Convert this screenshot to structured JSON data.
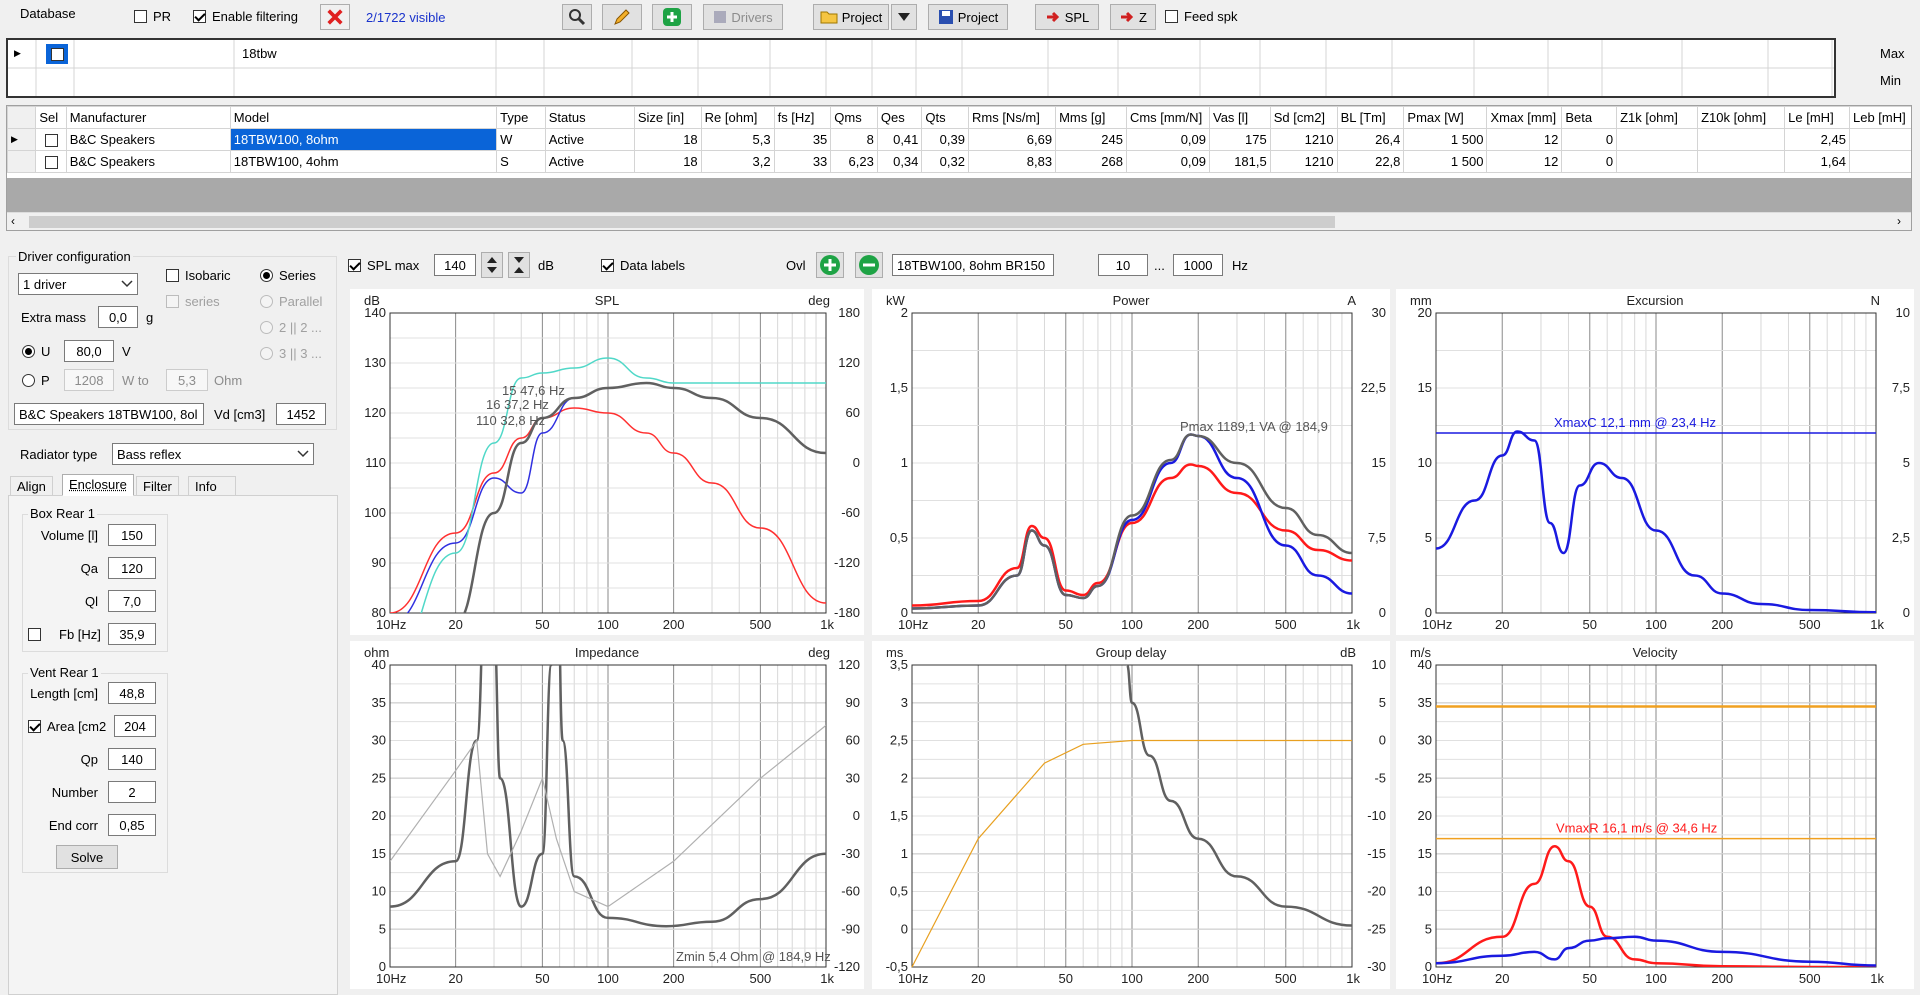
{
  "toolbar": {
    "database_label": "Database",
    "pr_label": "PR",
    "filter_label": "Enable filtering",
    "visible_count": "2/1722 visible",
    "drivers_label": "Drivers",
    "project_label": "Project",
    "project2_label": "Project",
    "spl_label": "SPL",
    "z_label": "Z",
    "feed_label": "Feed spk",
    "colors": {
      "add": "#1ea345",
      "delete": "#e02020",
      "link": "#1a33cc"
    }
  },
  "filter_grid": {
    "text": "18tbw",
    "max_label": "Max",
    "min_label": "Min"
  },
  "table": {
    "columns": [
      "Sel",
      "Manufacturer",
      "Model",
      "Type",
      "Status",
      "Size [in]",
      "Re [ohm]",
      "fs [Hz]",
      "Qms",
      "Qes",
      "Qts",
      "Rms [Ns/m]",
      "Mms [g]",
      "Cms [mm/N]",
      "Vas [l]",
      "Sd [cm2]",
      "BL [Tm]",
      "Pmax [W]",
      "Xmax [mm]",
      "Beta",
      "Z1k [ohm]",
      "Z10k [ohm]",
      "Le [mH]",
      "Leb [mH]"
    ],
    "rows": [
      [
        "",
        "B&C Speakers",
        "18TBW100, 8ohm",
        "W",
        "Active",
        "18",
        "5,3",
        "35",
        "8",
        "0,41",
        "0,39",
        "6,69",
        "245",
        "0,09",
        "175",
        "1210",
        "26,4",
        "1 500",
        "12",
        "0",
        "",
        "",
        "2,45",
        ""
      ],
      [
        "",
        "B&C Speakers",
        "18TBW100, 4ohm",
        "S",
        "Active",
        "18",
        "3,2",
        "33",
        "6,23",
        "0,34",
        "0,32",
        "8,83",
        "268",
        "0,09",
        "181,5",
        "1210",
        "22,8",
        "1 500",
        "12",
        "0",
        "",
        "",
        "1,64",
        ""
      ]
    ]
  },
  "driver_config": {
    "title": "Driver configuration",
    "drivers_select": "1 driver",
    "isobaric": "Isobaric",
    "series_opt": "Series",
    "series_dis": "series",
    "parallel": "Parallel",
    "opt_22": "2 || 2 ...",
    "opt_33": "3 || 3 ...",
    "extra_mass_label": "Extra mass",
    "extra_mass": "0,0",
    "extra_mass_unit": "g",
    "u_label": "U",
    "u_value": "80,0",
    "u_unit": "V",
    "p_label": "P",
    "p_value": "1208",
    "w_to": "W to",
    "ohm_value": "5,3",
    "ohm_unit": "Ohm",
    "driver_name": "B&C Speakers 18TBW100, 8ol",
    "vd_label": "Vd [cm3]",
    "vd_value": "1452",
    "radiator_label": "Radiator type",
    "radiator_value": "Bass reflex"
  },
  "tabs": [
    "Align",
    "Enclosure",
    "Filter",
    "Info"
  ],
  "box": {
    "title": "Box Rear 1",
    "volume_label": "Volume [l]",
    "volume": "150",
    "qa_label": "Qa",
    "qa": "120",
    "ql_label": "Ql",
    "ql": "7,0",
    "fb_label": "Fb [Hz]",
    "fb": "35,9"
  },
  "vent": {
    "title": "Vent Rear 1",
    "length_label": "Length [cm]",
    "length": "48,8",
    "area_label": "Area [cm2",
    "area": "204",
    "qp_label": "Qp",
    "qp": "140",
    "number_label": "Number",
    "number": "2",
    "endcorr_label": "End corr",
    "endcorr": "0,85",
    "solve_label": "Solve"
  },
  "chart_toolbar": {
    "splmax_label": "SPL max",
    "splmax": "140",
    "db_unit": "dB",
    "datalabels": "Data labels",
    "ovl": "Ovl",
    "overlay_name": "18TBW100, 8ohm BR150",
    "f_from": "10",
    "dots": "...",
    "f_to": "1000",
    "hz_unit": "Hz"
  },
  "charts": [
    {
      "title": "SPL",
      "left_unit": "dB",
      "right_unit": "deg",
      "yl": [
        80,
        140
      ],
      "yl_ticks": [
        "140",
        "130",
        "120",
        "110",
        "100",
        "90",
        "80"
      ],
      "yr_ticks": [
        "180",
        "120",
        "60",
        "0",
        "-60",
        "-120",
        "-180"
      ],
      "annotations": [
        "15 47,6 Hz",
        "16 37,2 Hz",
        "110 32,8 Hz"
      ]
    },
    {
      "title": "Power",
      "left_unit": "kW",
      "right_unit": "A",
      "yl": [
        0,
        2
      ],
      "yl_ticks": [
        "2",
        "1,5",
        "1",
        "0,5",
        "0"
      ],
      "yr_ticks": [
        "30",
        "22,5",
        "15",
        "7,5",
        "0"
      ],
      "annotations": [
        "Pmax 1189,1 VA  @ 184,9"
      ]
    },
    {
      "title": "Excursion",
      "left_unit": "mm",
      "right_unit": "N",
      "yl": [
        0,
        20
      ],
      "yl_ticks": [
        "20",
        "15",
        "10",
        "5",
        "0"
      ],
      "yr_ticks": [
        "10",
        "7,5",
        "5",
        "2,5",
        "0"
      ],
      "annotations": [
        "XmaxC 12,1 mm  @ 23,4 Hz"
      ]
    },
    {
      "title": "Impedance",
      "left_unit": "ohm",
      "right_unit": "deg",
      "yl": [
        0,
        40
      ],
      "yl_ticks": [
        "40",
        "35",
        "30",
        "25",
        "20",
        "15",
        "10",
        "5",
        "0"
      ],
      "yr_ticks": [
        "120",
        "90",
        "60",
        "30",
        "0",
        "-30",
        "-60",
        "-90",
        "-120"
      ],
      "annotations": [
        "Zmin 5,4 Ohm @ 184,9 Hz"
      ]
    },
    {
      "title": "Group delay",
      "left_unit": "ms",
      "right_unit": "dB",
      "yl": [
        -0.5,
        3.5
      ],
      "yl_ticks": [
        "3,5",
        "3",
        "2,5",
        "2",
        "1,5",
        "1",
        "0,5",
        "0",
        "-0,5"
      ],
      "yr_ticks": [
        "10",
        "5",
        "0",
        "-5",
        "-10",
        "-15",
        "-20",
        "-25",
        "-30"
      ],
      "annotations": []
    },
    {
      "title": "Velocity",
      "left_unit": "m/s",
      "right_unit": "",
      "yl": [
        0,
        40
      ],
      "yl_ticks": [
        "40",
        "35",
        "30",
        "25",
        "20",
        "15",
        "10",
        "5",
        "0"
      ],
      "yr_ticks": [],
      "annotations": [
        "VmaxR 16,1 m/s @ 34,6 Hz"
      ]
    }
  ],
  "x_ticks": [
    "10Hz",
    "20",
    "50",
    "100",
    "200",
    "500",
    "1k"
  ],
  "chart_data": [
    {
      "type": "line",
      "title": "SPL",
      "x": [
        10,
        20,
        30,
        40,
        50,
        70,
        100,
        150,
        200,
        300,
        500,
        1000
      ],
      "series": [
        {
          "color": "#ff3030",
          "values": [
            80,
            96,
            108,
            115,
            119,
            121,
            120,
            116,
            112,
            106,
            97,
            82
          ]
        },
        {
          "color": "#3030e0",
          "values": [
            78,
            94,
            107,
            104,
            116,
            123,
            125,
            126,
            125,
            123,
            119,
            112
          ]
        },
        {
          "color": "#606060",
          "values": [
            60,
            78,
            100,
            114,
            119,
            123,
            125,
            126,
            125,
            123,
            119,
            112
          ]
        },
        {
          "color": "#50d8c8",
          "values": [
            70,
            92,
            114,
            127,
            128,
            129,
            131,
            127,
            126,
            126,
            126,
            126
          ]
        }
      ]
    },
    {
      "type": "line",
      "title": "Power",
      "x": [
        10,
        20,
        30,
        35,
        40,
        50,
        60,
        70,
        100,
        150,
        185,
        200,
        300,
        500,
        700,
        1000
      ],
      "series": [
        {
          "color": "#ff1a1a",
          "values": [
            0.05,
            0.08,
            0.3,
            0.58,
            0.5,
            0.15,
            0.12,
            0.2,
            0.6,
            0.9,
            0.99,
            0.98,
            0.8,
            0.55,
            0.42,
            0.35
          ]
        },
        {
          "color": "#1a1ae0",
          "values": [
            0.03,
            0.05,
            0.25,
            0.55,
            0.45,
            0.12,
            0.1,
            0.18,
            0.62,
            1.0,
            1.19,
            1.18,
            0.9,
            0.45,
            0.25,
            0.13
          ]
        },
        {
          "color": "#606060",
          "values": [
            0.03,
            0.05,
            0.25,
            0.55,
            0.45,
            0.12,
            0.1,
            0.18,
            0.65,
            1.02,
            1.19,
            1.18,
            1.0,
            0.7,
            0.52,
            0.4
          ]
        }
      ]
    },
    {
      "type": "line",
      "title": "Excursion",
      "x": [
        10,
        15,
        20,
        23.4,
        28,
        33,
        38,
        45,
        55,
        70,
        100,
        150,
        200,
        300,
        500,
        1000
      ],
      "series": [
        {
          "color": "#1a1ae0",
          "values": [
            4.3,
            7.5,
            10.5,
            12.1,
            11.5,
            6,
            4,
            8.5,
            10,
            9,
            5.5,
            2.5,
            1.3,
            0.6,
            0.2,
            0.05
          ]
        }
      ]
    },
    {
      "type": "line",
      "title": "Impedance",
      "x": [
        10,
        20,
        25,
        28,
        30,
        32,
        40,
        50,
        55,
        58,
        62,
        70,
        100,
        185,
        300,
        500,
        1000
      ],
      "series": [
        {
          "color": "#606060",
          "values": [
            8,
            14,
            30,
            60,
            45,
            25,
            8,
            15,
            40,
            60,
            30,
            12,
            6.5,
            5.4,
            6,
            9,
            15
          ]
        }
      ]
    },
    {
      "type": "line",
      "title": "Group delay",
      "x": [
        95,
        100,
        120,
        150,
        200,
        300,
        500,
        1000
      ],
      "series": [
        {
          "color": "#606060",
          "values": [
            3.5,
            3.0,
            2.3,
            1.7,
            1.2,
            0.7,
            0.3,
            0.05
          ]
        }
      ]
    },
    {
      "type": "line",
      "title": "Velocity",
      "x": [
        10,
        20,
        28,
        34.6,
        40,
        50,
        60,
        80,
        100,
        200,
        500,
        1000
      ],
      "series": [
        {
          "color": "#ff1a1a",
          "values": [
            0.5,
            4,
            11,
            16,
            14,
            8,
            4,
            1,
            0.5,
            0.1,
            0,
            0
          ]
        },
        {
          "color": "#1a1ae0",
          "values": [
            0.5,
            1.5,
            2,
            1,
            2.5,
            3.5,
            3.8,
            4,
            3.5,
            2,
            0.7,
            0.2
          ]
        }
      ]
    }
  ]
}
